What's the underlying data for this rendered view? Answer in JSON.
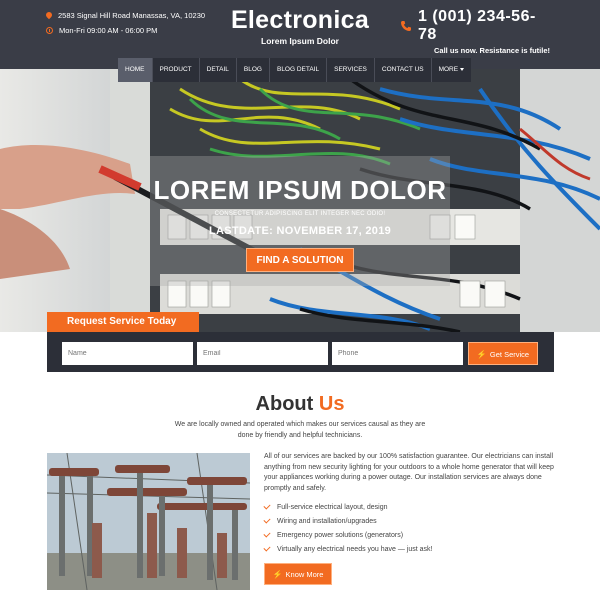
{
  "header": {
    "address": "2583 Signal Hill Road Manassas, VA, 10230",
    "hours": "Mon-Fri 09:00 AM - 06:00 PM",
    "brand_title": "Electronica",
    "brand_subtitle": "Lorem Ipsum Dolor",
    "phone": "1 (001) 234-56-78",
    "phone_tagline": "Call us now. Resistance is futile!"
  },
  "nav": {
    "items": [
      "HOME",
      "PRODUCT",
      "DETAIL",
      "BLOG",
      "BLOG DETAIL",
      "SERVICES",
      "CONTACT US",
      "MORE"
    ],
    "active": "HOME"
  },
  "hero": {
    "title": "LOREM IPSUM DOLOR",
    "subtitle": "CONSECTETUR ADIPISCING ELIT INTEGER NEC ODIO!",
    "date": "LASTDATE: NOVEMBER 17, 2019",
    "button": "FIND A SOLUTION"
  },
  "request": {
    "title": "Request Service Today",
    "name_placeholder": "Name",
    "email_placeholder": "Email",
    "phone_placeholder": "Phone",
    "button": "Get Service"
  },
  "about": {
    "title_main": "About",
    "title_accent": "Us",
    "intro": "We are locally owned and operated which makes our services causal as they are done by friendly and helpful technicians.",
    "body": "All of our services are backed by our 100% satisfaction guarantee. Our electricians can install anything from new security lighting for your outdoors to a whole home generator that will keep your appliances working during a power outage. Our installation services are always done promptly and safely.",
    "list": [
      "Full-service electrical layout, design",
      "Wiring and installation/upgrades",
      "Emergency power solutions (generators)",
      "Virtually any electrical needs you have — just ask!"
    ],
    "button": "Know More"
  },
  "colors": {
    "accent": "#f26b21",
    "header_bg": "#3a3d47",
    "nav_bg": "#2c2f38"
  }
}
